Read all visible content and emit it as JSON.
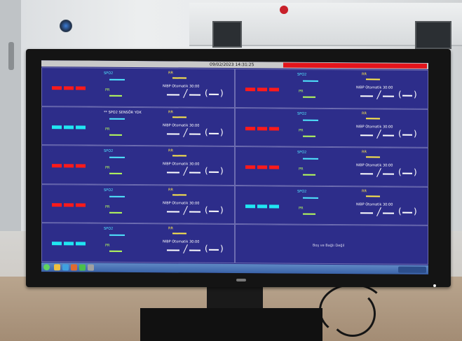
{
  "header": {
    "datetime": "09/02/2023 14:31:25",
    "alarm_color": "#e3141b"
  },
  "tiles": [
    {
      "id": "bed1",
      "blocks": "red",
      "mid1": "SPO2",
      "mid2": "PR",
      "right1": "RR",
      "nibp": "NIBP Otomatik 30:00",
      "extra": ""
    },
    {
      "id": "bed2",
      "blocks": "red",
      "mid1": "SPO2",
      "mid2": "PR",
      "right1": "RR",
      "nibp": "NIBP Otomatik 30:00",
      "extra": ""
    },
    {
      "id": "bed3",
      "blocks": "cyan",
      "mid1": "** SPO2 SENSÖR YOK",
      "mid2": "PR",
      "right1": "RR",
      "nibp": "NIBP Otomatik 30:00",
      "extra": ""
    },
    {
      "id": "bed4",
      "blocks": "red",
      "mid1": "SPO2",
      "mid2": "PR",
      "right1": "RR",
      "nibp": "NIBP Otomatik 30:00",
      "extra": ""
    },
    {
      "id": "bed5",
      "blocks": "red",
      "mid1": "SPO2",
      "mid2": "PR",
      "right1": "RR",
      "nibp": "NIBP Otomatik 30:00",
      "extra": ""
    },
    {
      "id": "bed6",
      "blocks": "red",
      "mid1": "SPO2",
      "mid2": "PR",
      "right1": "RR",
      "nibp": "NIBP Otomatik 30:00",
      "extra": ""
    },
    {
      "id": "bed7",
      "blocks": "red",
      "mid1": "SPO2",
      "mid2": "PR",
      "right1": "RR",
      "nibp": "NIBP Otomatik 30:00",
      "extra": ""
    },
    {
      "id": "bed8",
      "blocks": "cyan",
      "mid1": "SPO2",
      "mid2": "PR",
      "right1": "RR",
      "nibp": "NIBP Otomatik 30:00",
      "extra": ""
    },
    {
      "id": "bed9",
      "blocks": "cyan",
      "mid1": "SPO2",
      "mid2": "PR",
      "right1": "RR",
      "nibp": "NIBP Otomatik 30:00",
      "extra": ""
    }
  ],
  "empty_slot": {
    "message": "Boş ve Bağlı Değil"
  }
}
